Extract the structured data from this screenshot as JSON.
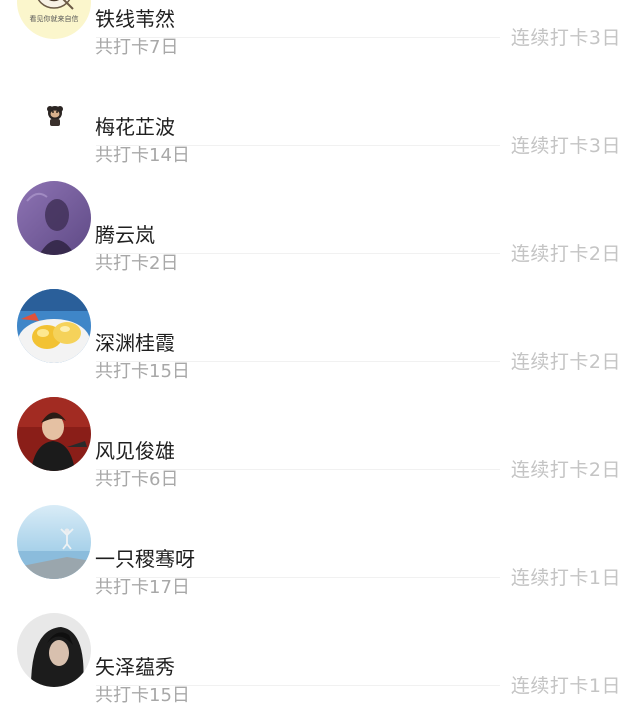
{
  "checkin_list": [
    {
      "name": "铁线苇然",
      "total": "共打卡7日",
      "streak": "连续打卡3日",
      "avatar_icon": "meme-face-avatar",
      "avatar_caption": "看见你就来自信"
    },
    {
      "name": "梅花芷波",
      "total": "共打卡14日",
      "streak": "连续打卡3日",
      "avatar_icon": "small-monkey-avatar"
    },
    {
      "name": "腾云岚",
      "total": "共打卡2日",
      "streak": "连续打卡2日",
      "avatar_icon": "purple-portrait-avatar"
    },
    {
      "name": "深渊桂霞",
      "total": "共打卡15日",
      "streak": "连续打卡2日",
      "avatar_icon": "food-dish-avatar"
    },
    {
      "name": "风见俊雄",
      "total": "共打卡6日",
      "streak": "连续打卡2日",
      "avatar_icon": "man-red-background-avatar"
    },
    {
      "name": "一只稷骞呀",
      "total": "共打卡17日",
      "streak": "连续打卡1日",
      "avatar_icon": "yoga-seaside-avatar"
    },
    {
      "name": "矢泽蕴秀",
      "total": "共打卡15日",
      "streak": "连续打卡1日",
      "avatar_icon": "dark-hair-portrait-avatar"
    }
  ]
}
